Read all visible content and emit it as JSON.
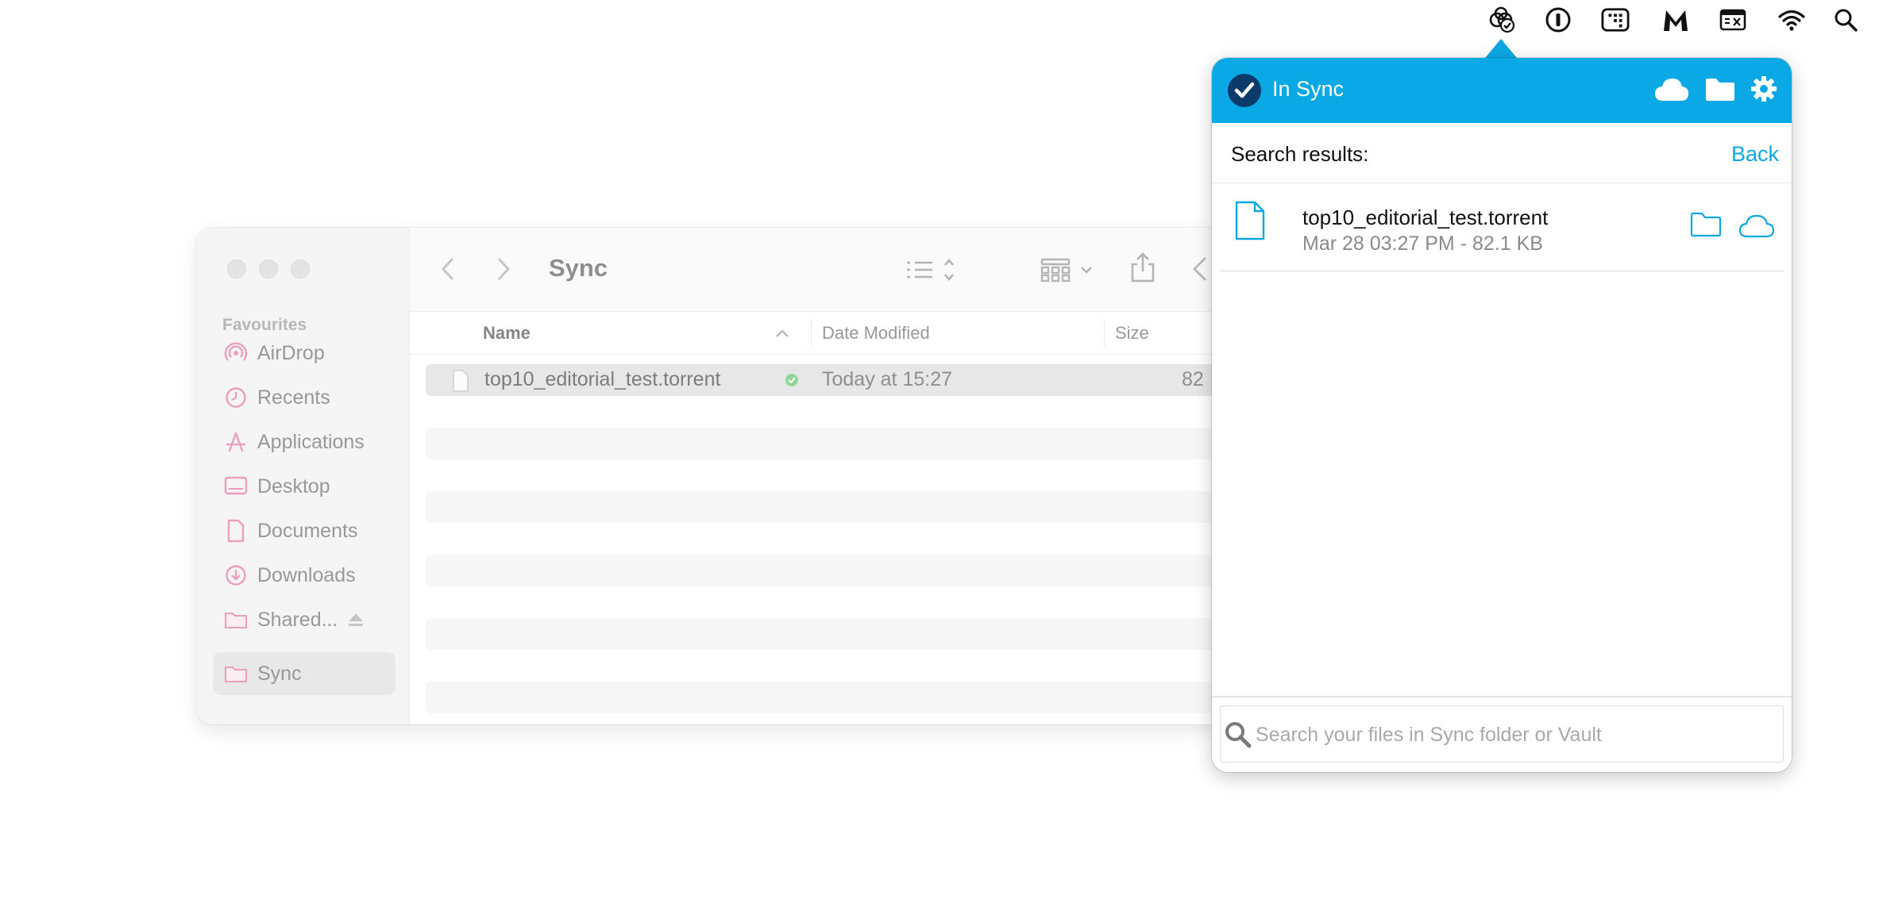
{
  "menubar": {
    "icons": [
      "sync-menubar-icon",
      "onepassword-icon",
      "grid-app-icon",
      "malwarebytes-icon",
      "window-manager-icon",
      "wifi-icon",
      "spotlight-search-icon"
    ]
  },
  "finder": {
    "title": "Sync",
    "sidebar": {
      "section": "Favourites",
      "items": [
        {
          "label": "AirDrop",
          "icon": "airdrop-icon"
        },
        {
          "label": "Recents",
          "icon": "clock-icon"
        },
        {
          "label": "Applications",
          "icon": "applications-icon"
        },
        {
          "label": "Desktop",
          "icon": "desktop-icon"
        },
        {
          "label": "Documents",
          "icon": "document-icon"
        },
        {
          "label": "Downloads",
          "icon": "download-icon"
        },
        {
          "label": "Shared...",
          "icon": "folder-icon"
        },
        {
          "label": "Sync",
          "icon": "folder-icon",
          "active": true
        }
      ]
    },
    "columns": {
      "name": "Name",
      "date": "Date Modified",
      "size": "Size"
    },
    "rows": [
      {
        "name": "top10_editorial_test.torrent",
        "date": "Today at 15:27",
        "size": "82"
      }
    ]
  },
  "popover": {
    "status": "In Sync",
    "accent": "#0aa9e5",
    "search_results_title": "Search results:",
    "back_label": "Back",
    "results": [
      {
        "name": "top10_editorial_test.torrent",
        "meta": "Mar 28 03:27 PM - 82.1 KB"
      }
    ],
    "search_placeholder": "Search your files in Sync folder or Vault"
  }
}
